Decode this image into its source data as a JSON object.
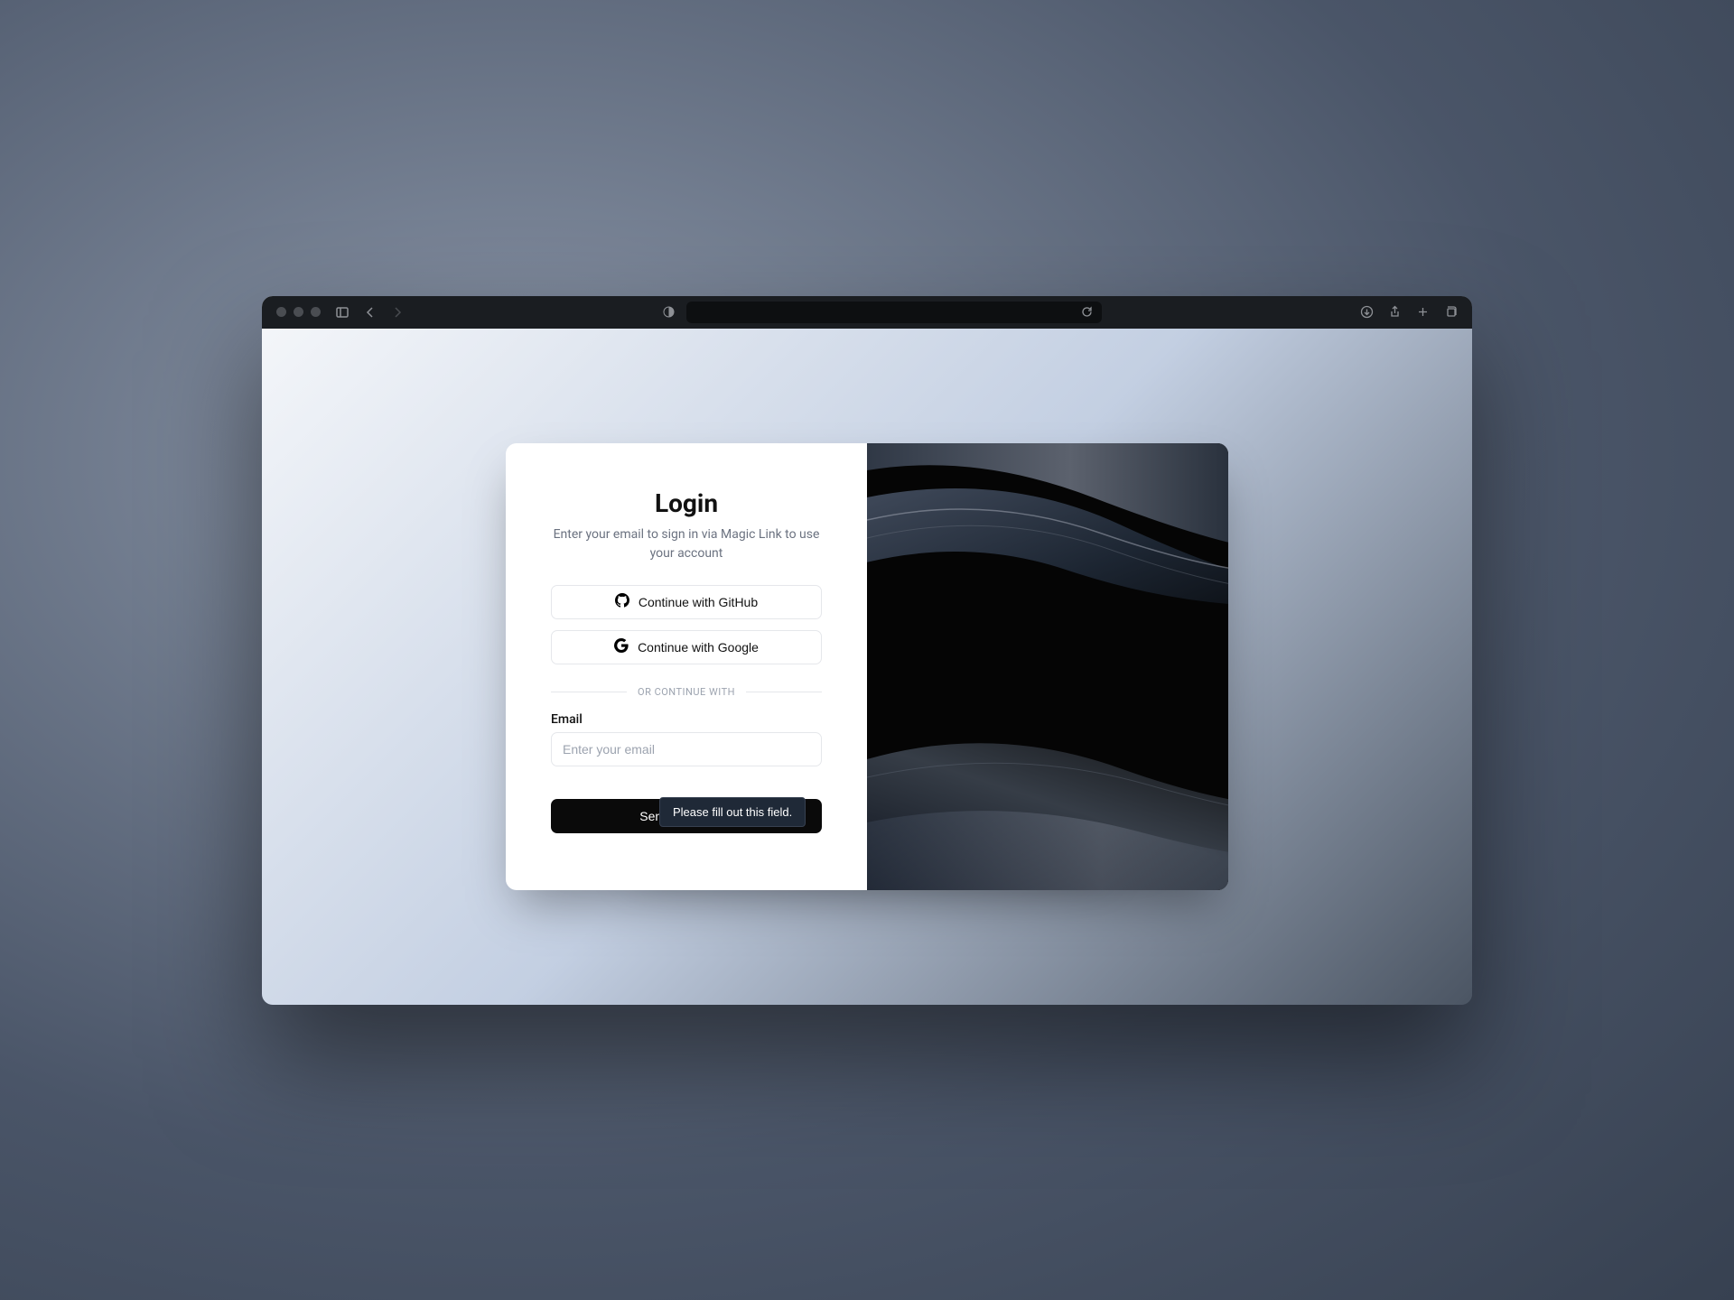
{
  "login": {
    "title": "Login",
    "subtitle": "Enter your email to sign in via Magic Link to use your account",
    "github_button": "Continue with GitHub",
    "google_button": "Continue with Google",
    "divider_text": "OR CONTINUE WITH",
    "email_label": "Email",
    "email_placeholder": "Enter your email",
    "submit_button": "Send Magic Link",
    "validation_message": "Please fill out this field."
  }
}
